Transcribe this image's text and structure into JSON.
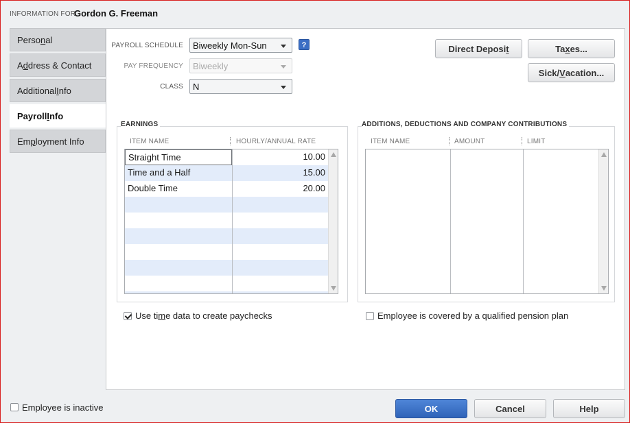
{
  "header": {
    "info_label": "INFORMATION FOR",
    "employee_name": "Gordon G. Freeman"
  },
  "tabs": [
    {
      "pre": "Perso",
      "key": "n",
      "post": "al",
      "active": false
    },
    {
      "pre": "A",
      "key": "d",
      "post": "dress & Contact",
      "active": false
    },
    {
      "pre": "Additional ",
      "key": "I",
      "post": "nfo",
      "active": false
    },
    {
      "pre": "Payroll ",
      "key": "I",
      "post": "nfo",
      "active": true
    },
    {
      "pre": "Em",
      "key": "p",
      "post": "loyment Info",
      "active": false
    }
  ],
  "payroll": {
    "schedule_label": "PAYROLL SCHEDULE",
    "schedule_value": "Biweekly Mon-Sun",
    "help_label": "?",
    "frequency_label": "PAY FREQUENCY",
    "frequency_value": "Biweekly",
    "class_label": "CLASS",
    "class_value": "N"
  },
  "buttons": {
    "direct_deposit": {
      "pre": "Direct Deposi",
      "key": "t",
      "post": ""
    },
    "taxes": {
      "pre": "Ta",
      "key": "x",
      "post": "es..."
    },
    "sick_vacation": {
      "pre": "Sick/",
      "key": "V",
      "post": "acation..."
    }
  },
  "earnings": {
    "title": "EARNINGS",
    "col_item": "ITEM NAME",
    "col_rate": "HOURLY/ANNUAL RATE",
    "rows": [
      {
        "name": "Straight Time",
        "rate": "10.00"
      },
      {
        "name": "Time and a Half",
        "rate": "15.00"
      },
      {
        "name": "Double Time",
        "rate": "20.00"
      }
    ]
  },
  "additions": {
    "title": "ADDITIONS, DEDUCTIONS AND COMPANY CONTRIBUTIONS",
    "col_item": "ITEM NAME",
    "col_amount": "AMOUNT",
    "col_limit": "LIMIT"
  },
  "checkboxes": {
    "use_time_data": {
      "pre": "Use ti",
      "key": "m",
      "post": "e data to create paychecks",
      "checked": true
    },
    "pension_plan": {
      "label": "Employee is covered by a qualified pension plan",
      "checked": false
    },
    "inactive": {
      "label": "Employee is inactive",
      "checked": false
    }
  },
  "footer": {
    "ok": "OK",
    "cancel": "Cancel",
    "help": "Help"
  },
  "colors": {
    "accent": "#3b6ec4",
    "alt_row": "#e3ecfa",
    "window_border": "#d81e1e"
  }
}
